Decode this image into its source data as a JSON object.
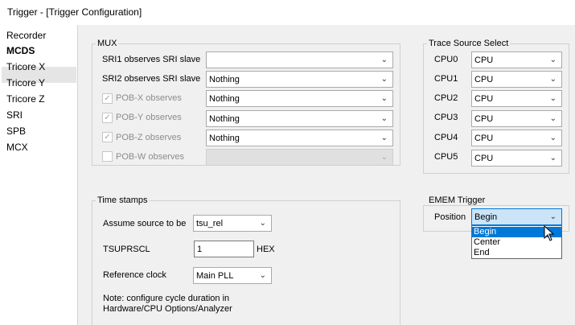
{
  "window": {
    "title": "Trigger - [Trigger Configuration]"
  },
  "sidebar": {
    "items": [
      {
        "label": "Recorder",
        "selected": false
      },
      {
        "label": "MCDS",
        "selected": true
      },
      {
        "label": "Tricore X",
        "selected": false
      },
      {
        "label": "Tricore Y",
        "selected": false
      },
      {
        "label": "Tricore Z",
        "selected": false
      },
      {
        "label": "SRI",
        "selected": false
      },
      {
        "label": "SPB",
        "selected": false
      },
      {
        "label": "MCX",
        "selected": false
      }
    ]
  },
  "mux": {
    "title": "MUX",
    "rows": [
      {
        "label": "SRI1 observes SRI slave",
        "value": ""
      },
      {
        "label": "SRI2 observes SRI slave",
        "value": "Nothing"
      },
      {
        "label": "POB-X observes",
        "value": "Nothing",
        "checked": true
      },
      {
        "label": "POB-Y observes",
        "value": "Nothing",
        "checked": true
      },
      {
        "label": "POB-Z observes",
        "value": "Nothing",
        "checked": true
      },
      {
        "label": "POB-W observes",
        "value": "",
        "checked": false
      }
    ]
  },
  "trace_source": {
    "title": "Trace Source Select",
    "rows": [
      {
        "label": "CPU0",
        "value": "CPU"
      },
      {
        "label": "CPU1",
        "value": "CPU"
      },
      {
        "label": "CPU2",
        "value": "CPU"
      },
      {
        "label": "CPU3",
        "value": "CPU"
      },
      {
        "label": "CPU4",
        "value": "CPU"
      },
      {
        "label": "CPU5",
        "value": "CPU"
      }
    ]
  },
  "timestamps": {
    "title": "Time stamps",
    "assume_label": "Assume source to be",
    "assume_value": "tsu_rel",
    "tsuprscl_label": "TSUPRSCL",
    "tsuprscl_value": "1",
    "hex_label": "HEX",
    "refclock_label": "Reference clock",
    "refclock_value": "Main PLL",
    "note_line1": "Note: configure cycle duration in",
    "note_line2": "Hardware/CPU Options/Analyzer"
  },
  "emem": {
    "title": "EMEM Trigger",
    "position_label": "Position",
    "position_value": "Begin",
    "options": [
      "Begin",
      "Center",
      "End"
    ],
    "highlighted_option": "Begin"
  },
  "icons": {
    "dropdown_arrow": "chevron-down-icon",
    "checkmark": "check-icon",
    "pointer": "mouse-pointer-icon"
  },
  "colors": {
    "selection": "#0078d7",
    "active_combo": "#cce4f7",
    "panel_bg": "#f0f0f0"
  }
}
